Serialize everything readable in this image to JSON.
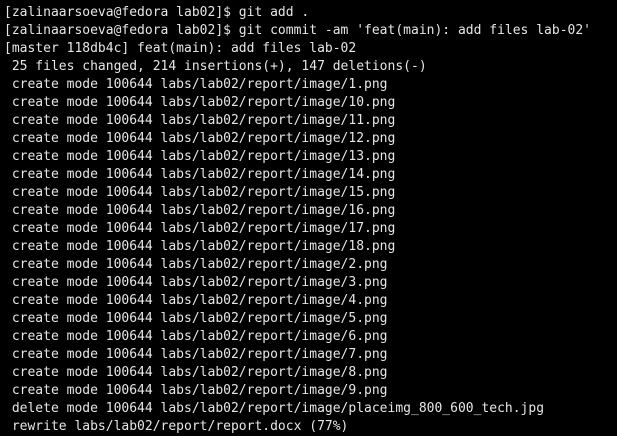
{
  "terminal": {
    "lines": [
      "[zalinaarsoeva@fedora lab02]$ git add .",
      "[zalinaarsoeva@fedora lab02]$ git commit -am 'feat(main): add files lab-02'",
      "[master 118db4c] feat(main): add files lab-02",
      " 25 files changed, 214 insertions(+), 147 deletions(-)",
      " create mode 100644 labs/lab02/report/image/1.png",
      " create mode 100644 labs/lab02/report/image/10.png",
      " create mode 100644 labs/lab02/report/image/11.png",
      " create mode 100644 labs/lab02/report/image/12.png",
      " create mode 100644 labs/lab02/report/image/13.png",
      " create mode 100644 labs/lab02/report/image/14.png",
      " create mode 100644 labs/lab02/report/image/15.png",
      " create mode 100644 labs/lab02/report/image/16.png",
      " create mode 100644 labs/lab02/report/image/17.png",
      " create mode 100644 labs/lab02/report/image/18.png",
      " create mode 100644 labs/lab02/report/image/2.png",
      " create mode 100644 labs/lab02/report/image/3.png",
      " create mode 100644 labs/lab02/report/image/4.png",
      " create mode 100644 labs/lab02/report/image/5.png",
      " create mode 100644 labs/lab02/report/image/6.png",
      " create mode 100644 labs/lab02/report/image/7.png",
      " create mode 100644 labs/lab02/report/image/8.png",
      " create mode 100644 labs/lab02/report/image/9.png",
      " delete mode 100644 labs/lab02/report/image/placeimg_800_600_tech.jpg",
      " rewrite labs/lab02/report/report.docx (77%)"
    ]
  }
}
